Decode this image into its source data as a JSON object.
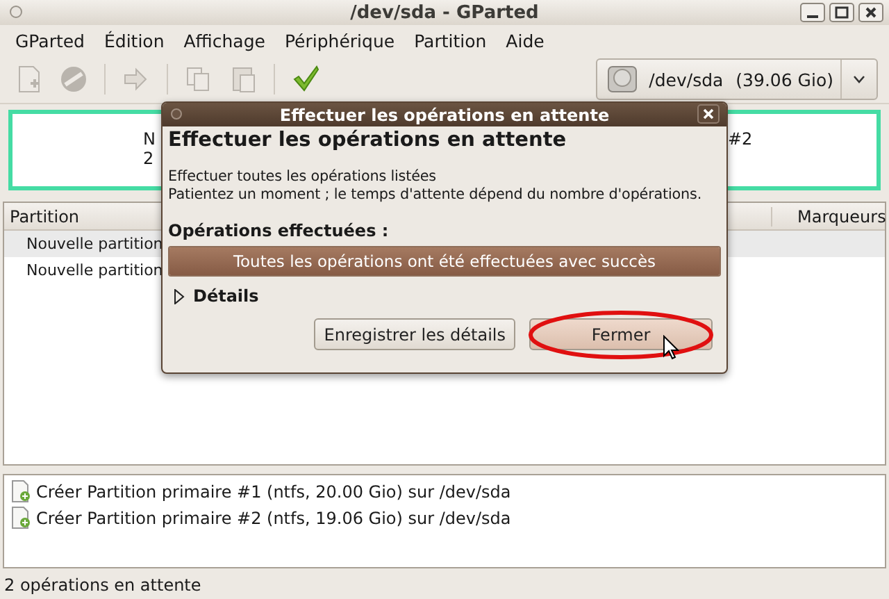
{
  "window": {
    "title": "/dev/sda - GParted"
  },
  "menu": [
    "GParted",
    "Édition",
    "Affichage",
    "Périphérique",
    "Partition",
    "Aide"
  ],
  "toolbar": [
    {
      "kind": "new",
      "disabled": true
    },
    {
      "kind": "delete",
      "disabled": true
    },
    {
      "kind": "resize",
      "disabled": true
    },
    {
      "kind": "copy",
      "disabled": true
    },
    {
      "kind": "paste",
      "disabled": true
    },
    {
      "kind": "apply",
      "disabled": false
    }
  ],
  "device": {
    "name": "/dev/sda",
    "size": "(39.06 Gio)"
  },
  "disk_map": {
    "left_lines": [
      "N",
      "2"
    ],
    "right_label": "#2"
  },
  "table": {
    "columns": [
      "Partition",
      "Marqueurs"
    ],
    "rows": [
      "Nouvelle partition",
      "Nouvelle partition"
    ]
  },
  "operations": [
    "Créer Partition primaire #1 (ntfs, 20.00 Gio) sur /dev/sda",
    "Créer Partition primaire #2 (ntfs, 19.06 Gio) sur /dev/sda"
  ],
  "status_bar": "2 opérations en attente",
  "dialog": {
    "title": "Effectuer les opérations en attente",
    "heading": "Effectuer les opérations en attente",
    "lines": [
      "Effectuer toutes les opérations listées",
      "Patientez un moment ; le temps d'attente dépend du nombre d'opérations."
    ],
    "progress_label": "Opérations effectuées :",
    "progress": {
      "level": 1,
      "text": "Toutes les opérations ont été effectuées avec succès"
    },
    "details": {
      "label": "Détails",
      "expanded": false
    },
    "buttons": [
      {
        "label": "Enregistrer les détails",
        "highlighted": false
      },
      {
        "label": "Fermer",
        "highlighted": true
      }
    ]
  }
}
